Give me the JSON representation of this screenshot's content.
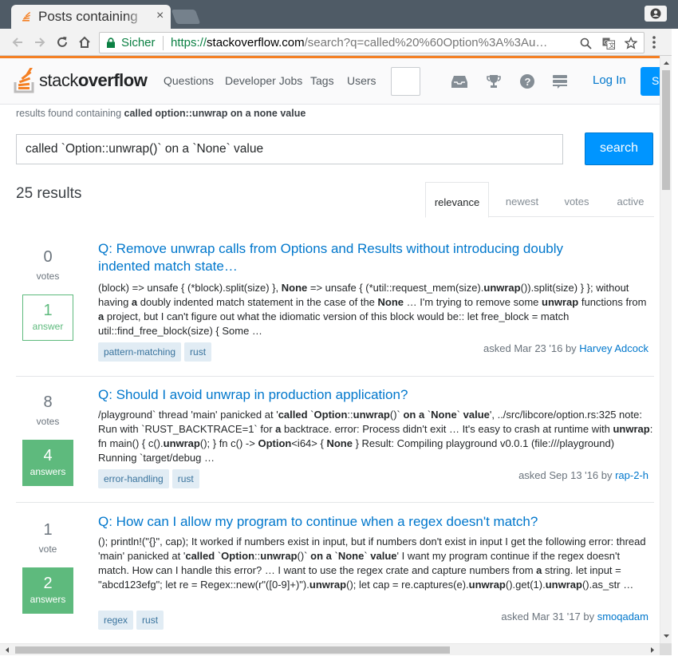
{
  "browser": {
    "tab_title": "Posts containing",
    "tab_close": "×",
    "secure_label": "Sicher",
    "url_scheme": "https://",
    "url_host": "stackoverflow.com",
    "url_path": "/search?q=called%20%60Option%3A%3Au…"
  },
  "header": {
    "logo_light": "stack",
    "logo_bold": "overflow",
    "nav": [
      "Questions",
      "Developer Jobs",
      "Tags",
      "Users"
    ],
    "login_label": "Log In",
    "signup_label": "S"
  },
  "search": {
    "found_prefix": "results found containing ",
    "found_query": "called option::unwrap on a none value",
    "query": "called `Option::unwrap()` on a `None` value",
    "button_label": "search"
  },
  "results_count": "25 results",
  "sort_tabs": [
    "relevance",
    "newest",
    "votes",
    "active"
  ],
  "active_sort": "relevance",
  "results": [
    {
      "votes": "0",
      "votes_label": "votes",
      "answers": "1",
      "answers_label": "answer",
      "accepted_style": "outline",
      "title_line1": "Q: Remove unwrap calls from Options and Results without introducing doubly",
      "title_line2": "indented match state…",
      "excerpt_html": "(block) =&gt; unsafe { (*block).split(size) }, <b>None</b> =&gt; unsafe { (*util::request_mem(size).<b>unwrap</b>()).split(size) } }; without having <b>a</b> doubly indented match statement in the case of the <b>None</b> … I'm trying to remove some <b>unwrap</b> functions from <b>a</b> project, but I can't figure out what the idiomatic version of this block would be:: let free_block = match util::find_free_block(size) { Some …",
      "tags": [
        "pattern-matching",
        "rust"
      ],
      "asked": "asked Mar 23 '16 by ",
      "user": "Harvey Adcock"
    },
    {
      "votes": "8",
      "votes_label": "votes",
      "answers": "4",
      "answers_label": "answers",
      "accepted_style": "filled",
      "title_line1": "Q: Should I avoid unwrap in production application?",
      "title_line2": "",
      "excerpt_html": "/playground` thread 'main' panicked at '<b>called</b> `<b>Option</b>::<b>unwrap</b>()` <b>on a</b> `<b>None</b>` <b>value</b>', ../src/libcore/option.rs:325 note: Run with `RUST_BACKTRACE=1` for <b>a</b> backtrace. error: Process didn't exit … It's easy to crash at runtime with <b>unwrap</b>: fn main() { c().<b>unwrap</b>(); } fn c() -&gt; <b>Option</b>&lt;i64&gt; { <b>None</b> } Result: Compiling playground v0.0.1 (file:///playground) Running `target/debug …",
      "tags": [
        "error-handling",
        "rust"
      ],
      "asked": "asked Sep 13 '16 by ",
      "user": "rap-2-h"
    },
    {
      "votes": "1",
      "votes_label": "vote",
      "answers": "2",
      "answers_label": "answers",
      "accepted_style": "filled",
      "title_line1": "Q: How can I allow my program to continue when a regex doesn't match?",
      "title_line2": "",
      "excerpt_html": "(); println!(\"{}\", cap); It worked if numbers exist in input, but if numbers don't exist in input I get the following error: thread 'main' panicked at '<b>called</b> `<b>Option</b>::<b>unwrap</b>()` <b>on a</b> `<b>None</b>` <b>value</b>' I want my program continue if the regex doesn't match. How can I handle this error? … I want to use the regex crate and capture numbers from <b>a</b> string. let input = \"abcd123efg\"; let re = Regex::new(r\"([0-9]+)\").<b>unwrap</b>(); let cap = re.captures(e).<b>unwrap</b>().get(1).<b>unwrap</b>().as_str …",
      "tags": [
        "regex",
        "rust"
      ],
      "asked": "asked Mar 31 '17 by ",
      "user": "smoqadam"
    }
  ],
  "colors": {
    "accent": "#f48024",
    "link": "#0077cc",
    "button": "#0095ff",
    "answered": "#5eba7d",
    "tag_bg": "#e1ecf4",
    "tag_fg": "#39739d"
  }
}
